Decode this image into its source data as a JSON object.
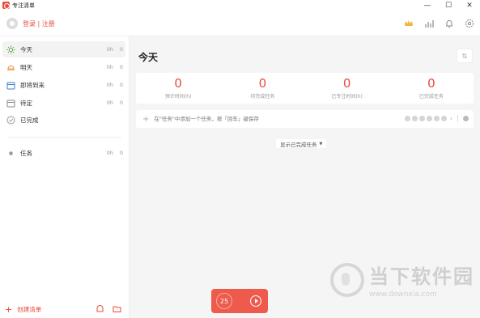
{
  "app": {
    "title": "专注清单"
  },
  "window": {
    "minimize": "—",
    "maximize": "☐",
    "close": "✕"
  },
  "header": {
    "login_label": "登录 | 注册"
  },
  "sidebar": {
    "items": [
      {
        "label": "今天",
        "hours": "0h",
        "count": "0"
      },
      {
        "label": "明天",
        "hours": "0h",
        "count": "0"
      },
      {
        "label": "即将到来",
        "hours": "0h",
        "count": "0"
      },
      {
        "label": "待定",
        "hours": "0h",
        "count": "0"
      },
      {
        "label": "已完成",
        "hours": "",
        "count": ""
      }
    ],
    "lists": [
      {
        "label": "任务",
        "hours": "0h",
        "count": "0"
      }
    ],
    "footer": {
      "add_list_label": "创建清单"
    }
  },
  "main": {
    "title": "今天",
    "stats": [
      {
        "value": "0",
        "label": "预计时间(h)"
      },
      {
        "value": "0",
        "label": "待完成任务"
      },
      {
        "value": "0",
        "label": "已专注时间(h)"
      },
      {
        "value": "0",
        "label": "已完成任务"
      }
    ],
    "add_task_placeholder": "在\"任务\"中添加一个任务，按「回车」键保存",
    "show_completed_label": "显示已完成任务"
  },
  "pomodoro": {
    "count": "25"
  },
  "watermark": {
    "name": "当下软件园",
    "url": "www.downxia.com"
  },
  "colors": {
    "accent": "#e84a3c",
    "pomodoro_bg": "#ee5a4c"
  }
}
